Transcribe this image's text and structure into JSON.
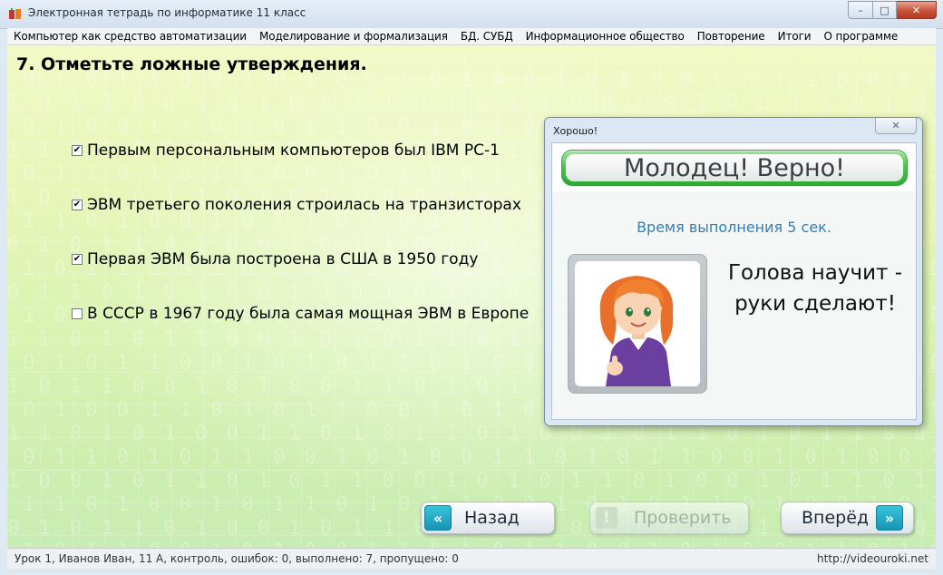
{
  "window": {
    "title": "Электронная тетрадь по информатике 11 класс",
    "controls": {
      "minimize": "–",
      "maximize": "□",
      "close": "✕"
    }
  },
  "menu": [
    "Компьютер как средство автоматизации",
    "Моделирование и формализация",
    "БД. СУБД",
    "Информационное общество",
    "Повторение",
    "Итоги",
    "О программе"
  ],
  "question": {
    "title": "7. Отметьте ложные утверждения.",
    "options": [
      {
        "label": "Первым персональным компьютеров был IBM PC-1",
        "checked": true
      },
      {
        "label": "ЭВМ третьего поколения строилась на транзисторах",
        "checked": true
      },
      {
        "label": "Первая ЭВМ была построена в США в 1950 году",
        "checked": true
      },
      {
        "label": "В СССР в 1967 году была самая мощная ЭВМ в Европе",
        "checked": false
      }
    ]
  },
  "nav": {
    "back_label": "Назад",
    "check_label": "Проверить",
    "next_label": "Вперёд",
    "back_icon": "«",
    "next_icon": "»",
    "check_icon": "!"
  },
  "status": {
    "text": "Урок 1, Иванов Иван, 11 А, контроль, ошибок: 0, выполнено: 7, пропущено: 0",
    "url": "http://videouroki.net"
  },
  "dialog": {
    "title": "Хорошо!",
    "close_icon": "✕",
    "banner": "Молодец! Верно!",
    "time": "Время выполнения 5 сек.",
    "quote_line1": "Голова научит -",
    "quote_line2": "руки сделают!"
  },
  "colors": {
    "accent_button": "#1795b4",
    "banner_green": "#48c24a",
    "time_text": "#2f7fb8"
  }
}
